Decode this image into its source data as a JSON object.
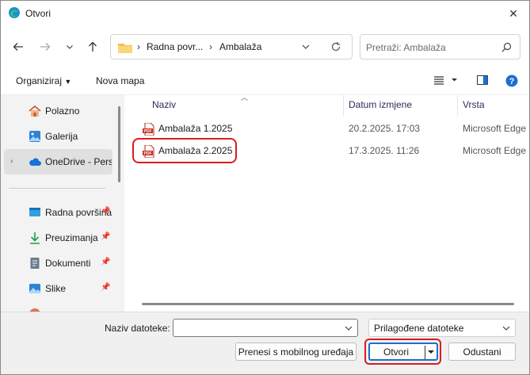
{
  "window": {
    "title": "Otvori"
  },
  "address": {
    "crumbs": [
      "Radna povr...",
      "Ambalaža"
    ]
  },
  "search": {
    "placeholder": "Pretraži: Ambalaža"
  },
  "toolbar": {
    "organize": "Organiziraj",
    "new_folder": "Nova mapa"
  },
  "sidebar": {
    "items": [
      {
        "label": "Polazno",
        "icon": "home-icon"
      },
      {
        "label": "Galerija",
        "icon": "gallery-icon"
      },
      {
        "label": "OneDrive - Personal",
        "icon": "cloud-icon",
        "selected": true
      },
      {
        "label": "Radna površina",
        "icon": "desktop-icon",
        "pinned": true
      },
      {
        "label": "Preuzimanja",
        "icon": "download-icon",
        "pinned": true
      },
      {
        "label": "Dokumenti",
        "icon": "document-icon",
        "pinned": true
      },
      {
        "label": "Slike",
        "icon": "pictures-icon",
        "pinned": true
      }
    ]
  },
  "columns": {
    "name": "Naziv",
    "date": "Datum izmjene",
    "type": "Vrsta"
  },
  "files": [
    {
      "name": "Ambalaža 1.2025",
      "date": "20.2.2025. 17:03",
      "type": "Microsoft Edge PDF Document"
    },
    {
      "name": "Ambalaža 2.2025",
      "date": "17.3.2025. 11:26",
      "type": "Microsoft Edge PDF Document",
      "highlighted": true
    }
  ],
  "footer": {
    "filename_label": "Naziv datoteke:",
    "filename_value": "",
    "filetype": "Prilagođene datoteke",
    "mobile_button": "Prenesi s mobilnog uređaja",
    "open_button": "Otvori",
    "cancel_button": "Odustani"
  },
  "colors": {
    "highlight": "#d61d1d",
    "accent": "#1a6fd1"
  }
}
